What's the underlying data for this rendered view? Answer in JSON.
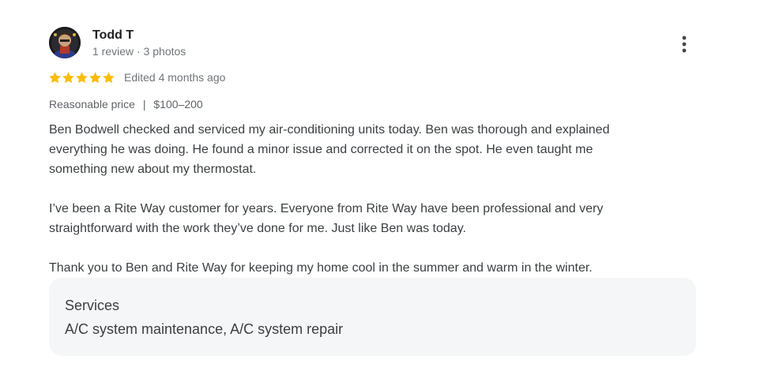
{
  "review": {
    "author": {
      "name": "Todd T",
      "meta": "1 review · 3 photos",
      "avatar_icon": "user-avatar-icon"
    },
    "menu_icon": "more-vert-icon",
    "rating": {
      "stars": 5,
      "max": 5,
      "star_color": "#fbbc04",
      "edited": "Edited 4 months ago"
    },
    "price": {
      "label": "Reasonable price",
      "separator": "|",
      "range": "$100–200"
    },
    "paragraphs": [
      {
        "lines": [
          "Ben Bodwell checked and serviced my air-conditioning units today. Ben was thorough and explained",
          "everything he was doing. He found a minor issue and corrected it on the spot. He even taught me",
          "something new about my thermostat."
        ]
      },
      {
        "lines": [
          "I’ve been a Rite Way customer for years. Everyone from Rite Way have been professional and very",
          "straightforward with the work they’ve done for me. Just like Ben was today."
        ]
      },
      {
        "lines": [
          "Thank you to Ben and Rite Way for keeping my home cool in the summer and warm in the winter."
        ]
      }
    ],
    "services": {
      "title": "Services",
      "list": "A/C system maintenance, A/C system repair"
    }
  }
}
